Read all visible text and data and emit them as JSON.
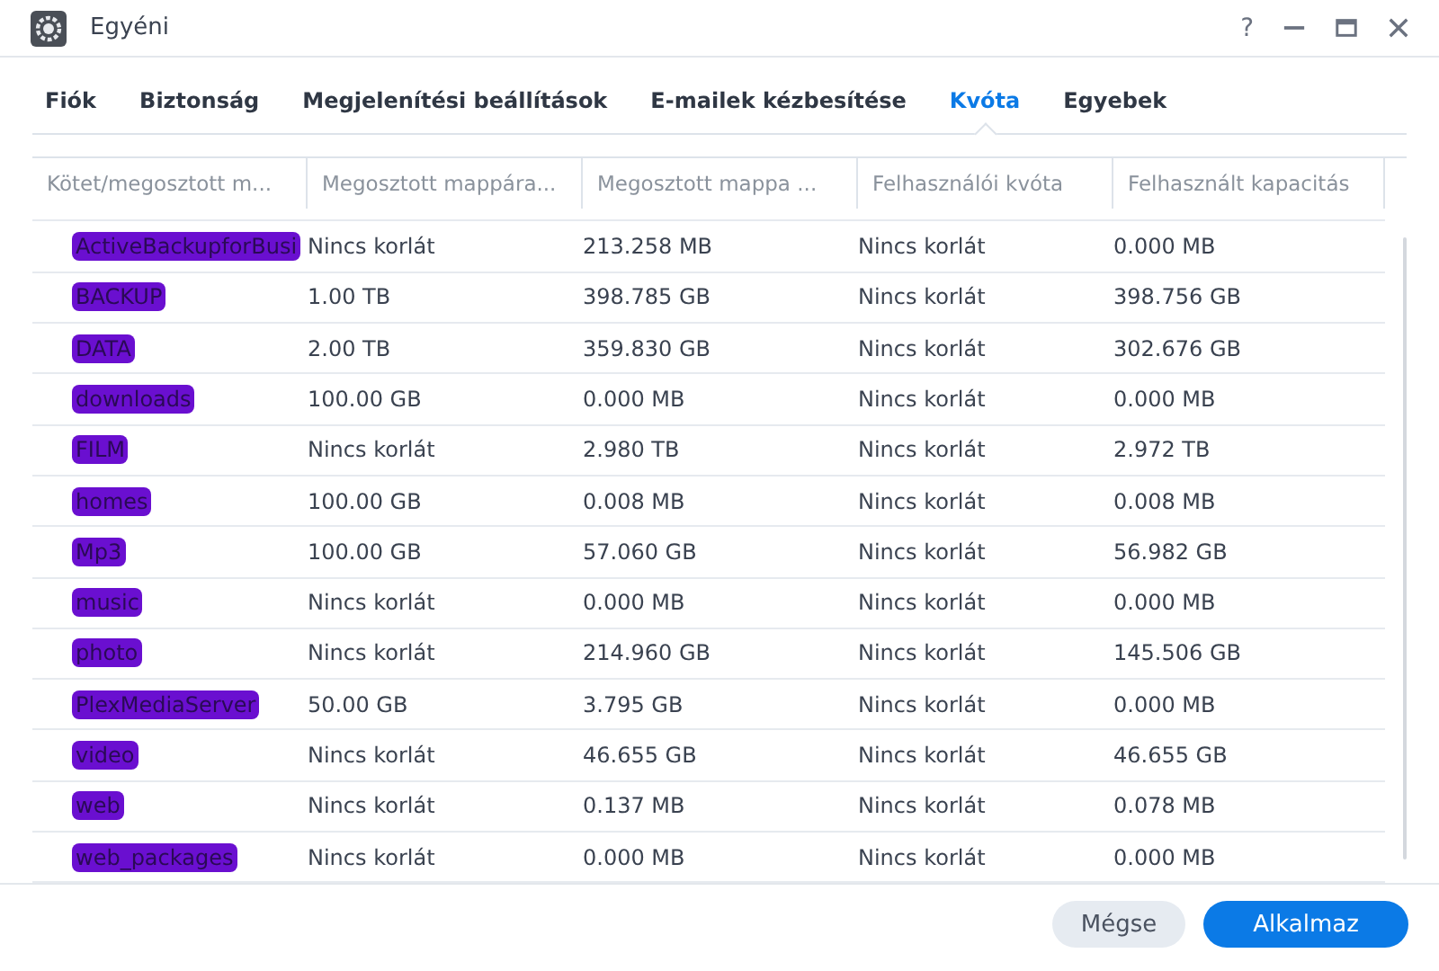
{
  "window": {
    "title": "Egyéni",
    "help": "?"
  },
  "tabs": [
    {
      "label": "Fiók",
      "selected": false
    },
    {
      "label": "Biztonság",
      "selected": false
    },
    {
      "label": "Megjelenítési beállítások",
      "selected": false
    },
    {
      "label": "E-mailek kézbesítése",
      "selected": false
    },
    {
      "label": "Kvóta",
      "selected": true
    },
    {
      "label": "Egyebek",
      "selected": false
    }
  ],
  "table": {
    "columns": [
      "Kötet/megosztott m...",
      "Megosztott mappára...",
      "Megosztott mappa ...",
      "Felhasználói kvóta",
      "Felhasznált kapacitás"
    ],
    "rows": [
      {
        "cells": [
          "ActiveBackupforBusi",
          "Nincs korlát",
          "213.258 MB",
          "Nincs korlát",
          "0.000 MB"
        ],
        "redacted": true
      },
      {
        "cells": [
          "BACKUP",
          "1.00 TB",
          "398.785 GB",
          "Nincs korlát",
          "398.756 GB"
        ],
        "redacted": true
      },
      {
        "cells": [
          "DATA",
          "2.00 TB",
          "359.830 GB",
          "Nincs korlát",
          "302.676 GB"
        ],
        "redacted": true
      },
      {
        "cells": [
          "downloads",
          "100.00 GB",
          "0.000 MB",
          "Nincs korlát",
          "0.000 MB"
        ],
        "redacted": true
      },
      {
        "cells": [
          "FILM",
          "Nincs korlát",
          "2.980 TB",
          "Nincs korlát",
          "2.972 TB"
        ],
        "redacted": true
      },
      {
        "cells": [
          "homes",
          "100.00 GB",
          "0.008 MB",
          "Nincs korlát",
          "0.008 MB"
        ],
        "redacted": true
      },
      {
        "cells": [
          "Mp3",
          "100.00 GB",
          "57.060 GB",
          "Nincs korlát",
          "56.982 GB"
        ],
        "redacted": true
      },
      {
        "cells": [
          "music",
          "Nincs korlát",
          "0.000 MB",
          "Nincs korlát",
          "0.000 MB"
        ],
        "redacted": true
      },
      {
        "cells": [
          "photo",
          "Nincs korlát",
          "214.960 GB",
          "Nincs korlát",
          "145.506 GB"
        ],
        "redacted": true
      },
      {
        "cells": [
          "PlexMediaServer",
          "50.00 GB",
          "3.795 GB",
          "Nincs korlát",
          "0.000 MB"
        ],
        "redacted": true
      },
      {
        "cells": [
          "video",
          "Nincs korlát",
          "46.655 GB",
          "Nincs korlát",
          "46.655 GB"
        ],
        "redacted": true
      },
      {
        "cells": [
          "web",
          "Nincs korlát",
          "0.137 MB",
          "Nincs korlát",
          "0.078 MB"
        ],
        "redacted": true
      },
      {
        "cells": [
          "web_packages",
          "Nincs korlát",
          "0.000 MB",
          "Nincs korlát",
          "0.000 MB"
        ],
        "redacted": true
      }
    ]
  },
  "buttons": [
    {
      "label": "Mégse",
      "kind": "secondary"
    },
    {
      "label": "Alkalmaz",
      "kind": "primary"
    }
  ]
}
